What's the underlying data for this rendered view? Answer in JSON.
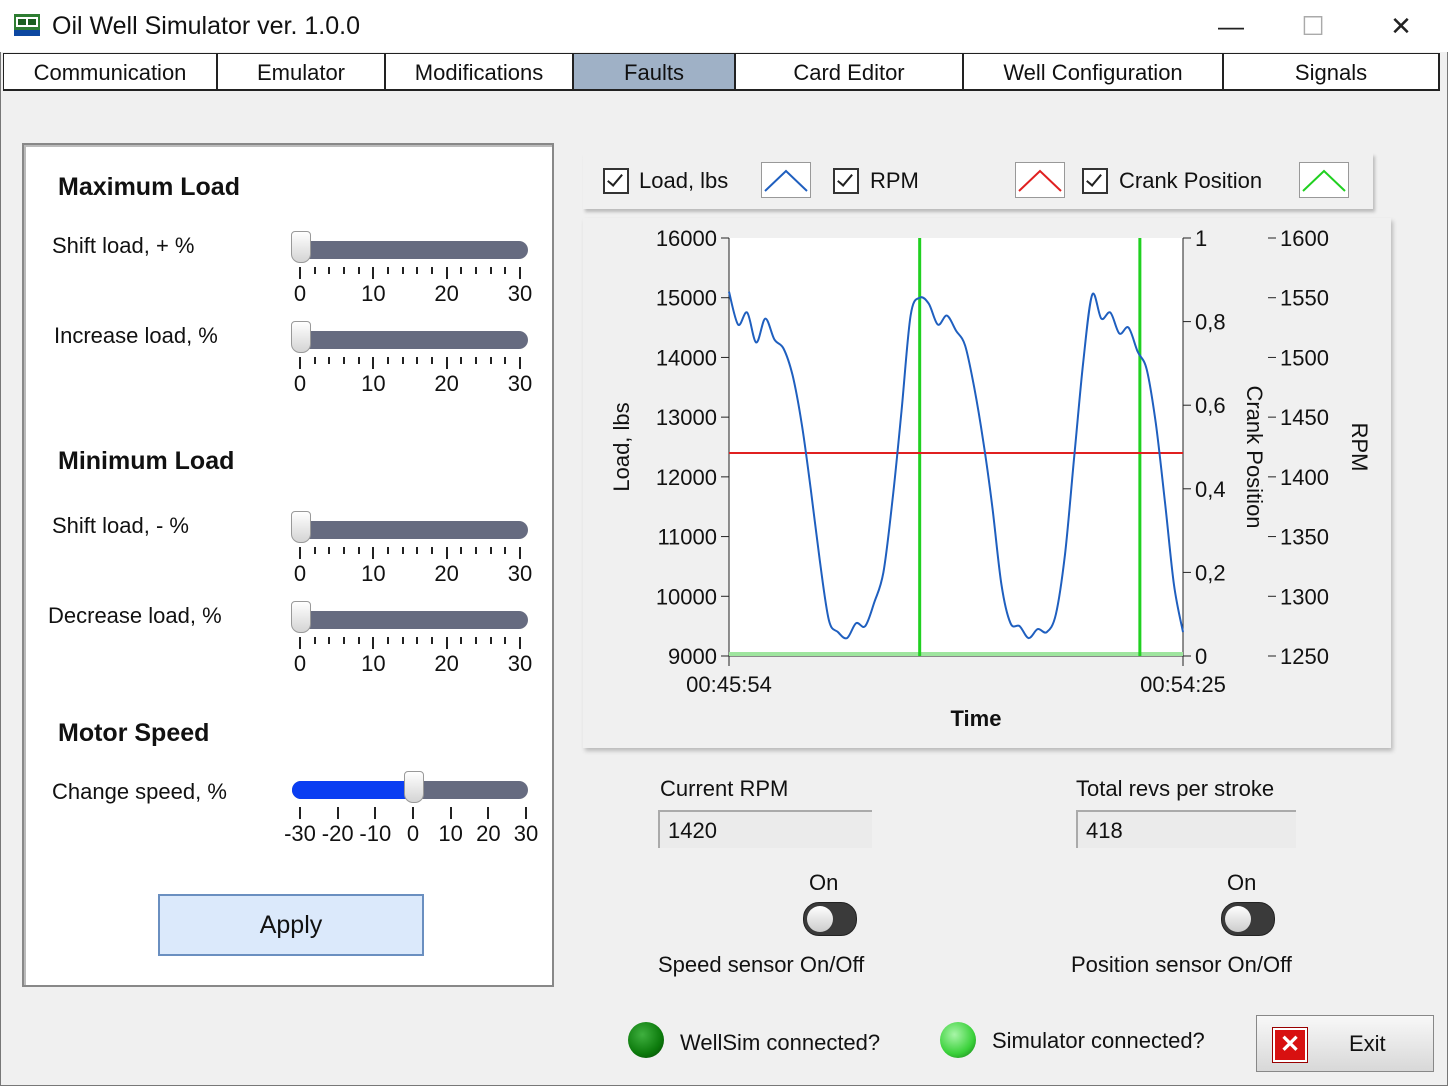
{
  "window": {
    "title": "Oil Well Simulator ver. 1.0.0",
    "min": "—",
    "max": "☐",
    "close": "✕"
  },
  "tabs": [
    "Communication",
    "Emulator",
    "Modifications",
    "Faults",
    "Card Editor",
    "Well Configuration",
    "Signals"
  ],
  "active_tab": "Faults",
  "panel": {
    "max_load_title": "Maximum Load",
    "shift_load_plus": {
      "label": "Shift load, + %",
      "value": 0
    },
    "increase_load": {
      "label": "Increase load, %",
      "value": 0
    },
    "min_load_title": "Minimum Load",
    "shift_load_minus": {
      "label": "Shift load, - %",
      "value": 0
    },
    "decrease_load": {
      "label": "Decrease load, %",
      "value": 0
    },
    "scale_0_30": [
      "0",
      "10",
      "20",
      "30"
    ],
    "motor_speed_title": "Motor Speed",
    "change_speed": {
      "label": "Change speed, %",
      "value": 0
    },
    "scale_speed": [
      "-30",
      "-20",
      "-10",
      "0",
      "10",
      "20",
      "30"
    ],
    "apply": "Apply"
  },
  "legend": [
    {
      "label": "Load, lbs",
      "checked": true,
      "color": "#1f5fbf"
    },
    {
      "label": "RPM",
      "checked": true,
      "color": "#e02020"
    },
    {
      "label": "Crank Position",
      "checked": true,
      "color": "#20d020"
    }
  ],
  "chart_data": {
    "type": "line",
    "xlabel": "Time",
    "x_ticks": [
      "00:45:54",
      "00:54:25"
    ],
    "ylabel_left": "Load, lbs",
    "ylim_left": [
      9000,
      16000
    ],
    "yticks_left": [
      "16000",
      "15000",
      "14000",
      "13000",
      "12000",
      "11000",
      "10000",
      "9000"
    ],
    "ylabel_right1": "Crank Position",
    "ylim_right1": [
      0,
      1
    ],
    "yticks_right1": [
      "1",
      "0,8",
      "0,6",
      "0,4",
      "0,2",
      "0"
    ],
    "ylabel_right2": "RPM",
    "ylim_right2": [
      1250,
      1600
    ],
    "yticks_right2": [
      "1600",
      "1550",
      "1500",
      "1450",
      "1400",
      "1350",
      "1300",
      "1250"
    ],
    "series": [
      {
        "name": "Load, lbs",
        "color": "#1f5fbf",
        "t": [
          0,
          0.02,
          0.04,
          0.06,
          0.08,
          0.1,
          0.12,
          0.14,
          0.16,
          0.18,
          0.2,
          0.22,
          0.24,
          0.26,
          0.28,
          0.3,
          0.32,
          0.34,
          0.36,
          0.38,
          0.4,
          0.42,
          0.44,
          0.46,
          0.48,
          0.5,
          0.52,
          0.54,
          0.56,
          0.58,
          0.6,
          0.62,
          0.64,
          0.66,
          0.68,
          0.7,
          0.72,
          0.74,
          0.76,
          0.78,
          0.8,
          0.82,
          0.84,
          0.86,
          0.88,
          0.9,
          0.92,
          0.94,
          0.96,
          0.98,
          1.0
        ],
        "load": [
          15100,
          14550,
          14750,
          14250,
          14650,
          14300,
          14150,
          13700,
          12900,
          11800,
          10600,
          9600,
          9400,
          9300,
          9550,
          9500,
          9900,
          10400,
          11600,
          13100,
          14700,
          15000,
          14900,
          14550,
          14700,
          14450,
          14200,
          13500,
          12600,
          11500,
          10200,
          9550,
          9500,
          9300,
          9450,
          9400,
          9700,
          10700,
          12300,
          13900,
          15050,
          14650,
          14750,
          14400,
          14500,
          14100,
          13800,
          12900,
          11600,
          10200,
          9400
        ]
      },
      {
        "name": "RPM",
        "color": "#e02020",
        "value": 1420
      },
      {
        "name": "Crank Position",
        "color": "#20d020",
        "markers_t": [
          0.42,
          0.905
        ],
        "value": 0
      }
    ]
  },
  "current_rpm": {
    "label": "Current RPM",
    "value": "1420"
  },
  "total_revs": {
    "label": "Total revs per stroke",
    "value": "418"
  },
  "speed_sensor": {
    "on_label": "On",
    "label": "Speed sensor On/Off"
  },
  "position_sensor": {
    "on_label": "On",
    "label": "Position sensor On/Off"
  },
  "status": [
    {
      "label": "WellSim connected?",
      "color": "#0c7a0c"
    },
    {
      "label": "Simulator connected?",
      "color": "#3ad13a"
    }
  ],
  "exit": {
    "label": "Exit",
    "icon": "close-icon"
  }
}
